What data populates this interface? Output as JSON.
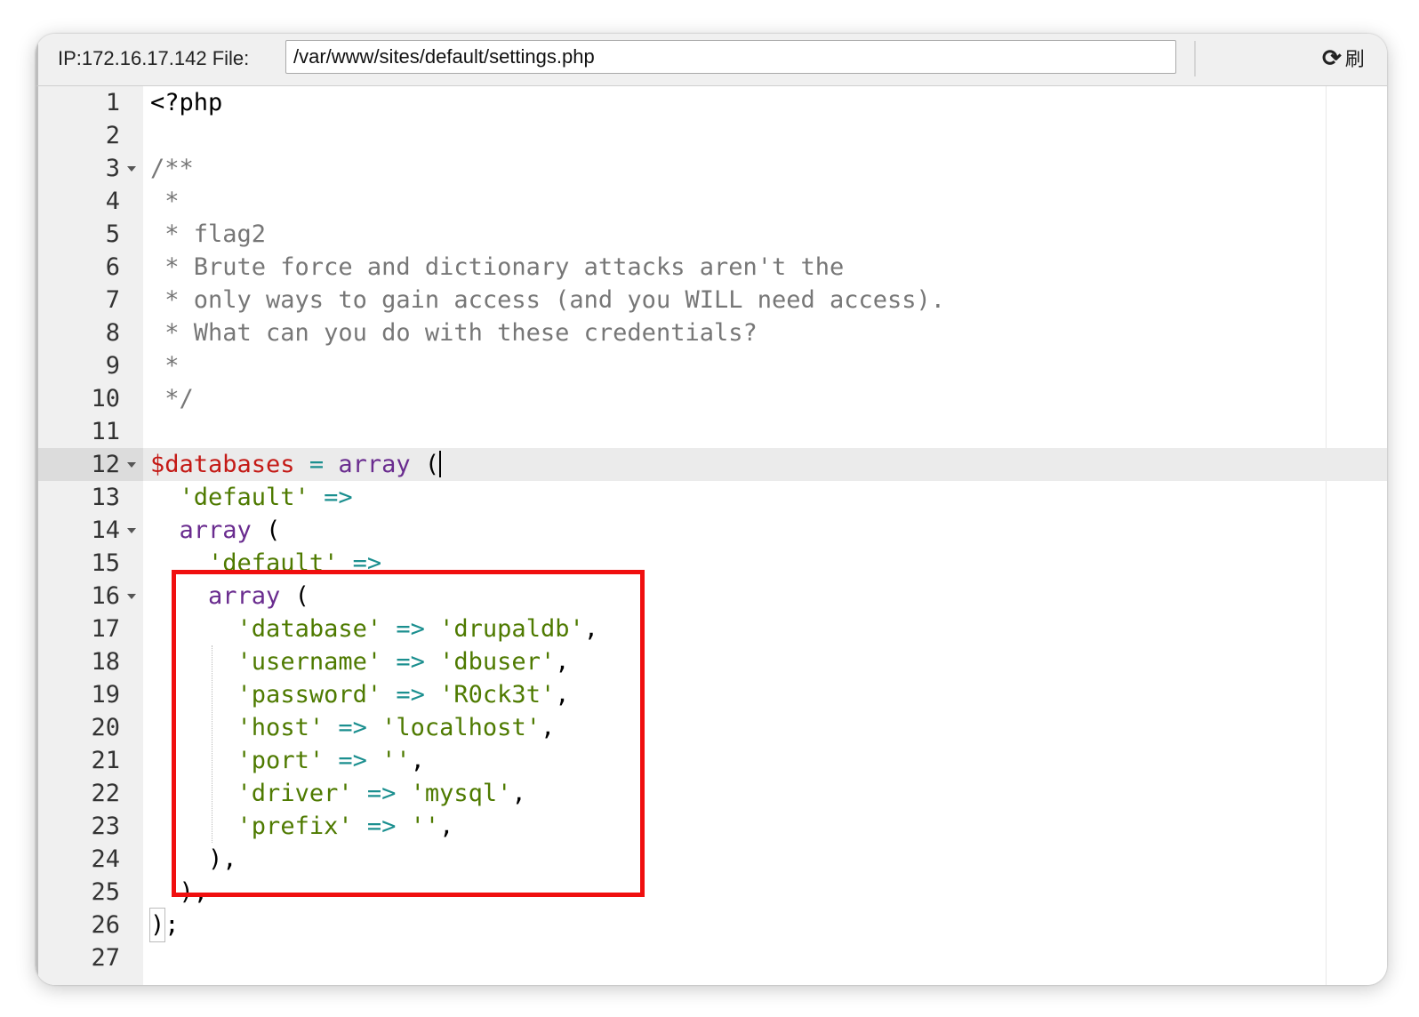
{
  "toolbar": {
    "ip_label": "IP:172.16.17.142 File:",
    "file_path": "/var/www/sites/default/settings.php",
    "refresh_icon": "refresh-icon",
    "refresh_label": "刷"
  },
  "editor": {
    "active_line": 12,
    "lines": [
      {
        "n": "1"
      },
      {
        "n": "2"
      },
      {
        "n": "3"
      },
      {
        "n": "4"
      },
      {
        "n": "5"
      },
      {
        "n": "6"
      },
      {
        "n": "7"
      },
      {
        "n": "8"
      },
      {
        "n": "9"
      },
      {
        "n": "10"
      },
      {
        "n": "11"
      },
      {
        "n": "12"
      },
      {
        "n": "13"
      },
      {
        "n": "14"
      },
      {
        "n": "15"
      },
      {
        "n": "16"
      },
      {
        "n": "17"
      },
      {
        "n": "18"
      },
      {
        "n": "19"
      },
      {
        "n": "20"
      },
      {
        "n": "21"
      },
      {
        "n": "22"
      },
      {
        "n": "23"
      },
      {
        "n": "24"
      },
      {
        "n": "25"
      },
      {
        "n": "26"
      },
      {
        "n": "27"
      }
    ],
    "code": {
      "l1": "<?php",
      "l3": "/**",
      "l4": " *",
      "l5": " * flag2",
      "l6": " * Brute force and dictionary attacks aren't the",
      "l7": " * only ways to gain access (and you WILL need access).",
      "l8": " * What can you do with these credentials?",
      "l9": " *",
      "l10": " */",
      "l12_var": "$databases",
      "l12_eq": "=",
      "l12_kw": "array",
      "l12_paren": "(",
      "l13_str": "'default'",
      "l13_op": "=>",
      "l14_kw": "array",
      "l14_paren": "(",
      "l15_str": "'default'",
      "l15_op": "=>",
      "l16_kw": "array",
      "l16_paren": "(",
      "entries": [
        {
          "key": "'database'",
          "op": "=>",
          "val": "'drupaldb'",
          "end": ","
        },
        {
          "key": "'username'",
          "op": "=>",
          "val": "'dbuser'",
          "end": ","
        },
        {
          "key": "'password'",
          "op": "=>",
          "val": "'R0ck3t'",
          "end": ","
        },
        {
          "key": "'host'",
          "op": "=>",
          "val": "'localhost'",
          "end": ","
        },
        {
          "key": "'port'",
          "op": "=>",
          "val": "''",
          "end": ","
        },
        {
          "key": "'driver'",
          "op": "=>",
          "val": "'mysql'",
          "end": ","
        },
        {
          "key": "'prefix'",
          "op": "=>",
          "val": "''",
          "end": ","
        }
      ],
      "l24": "),",
      "l25": "),",
      "l26_paren": ")",
      "l26_semi": ";"
    }
  },
  "colors": {
    "highlight_box": "#f00f0f",
    "comment": "#777777",
    "variable": "#c41a16",
    "keyword": "#6a2c8f",
    "string": "#4e7a00",
    "operator": "#1b8f8f"
  }
}
